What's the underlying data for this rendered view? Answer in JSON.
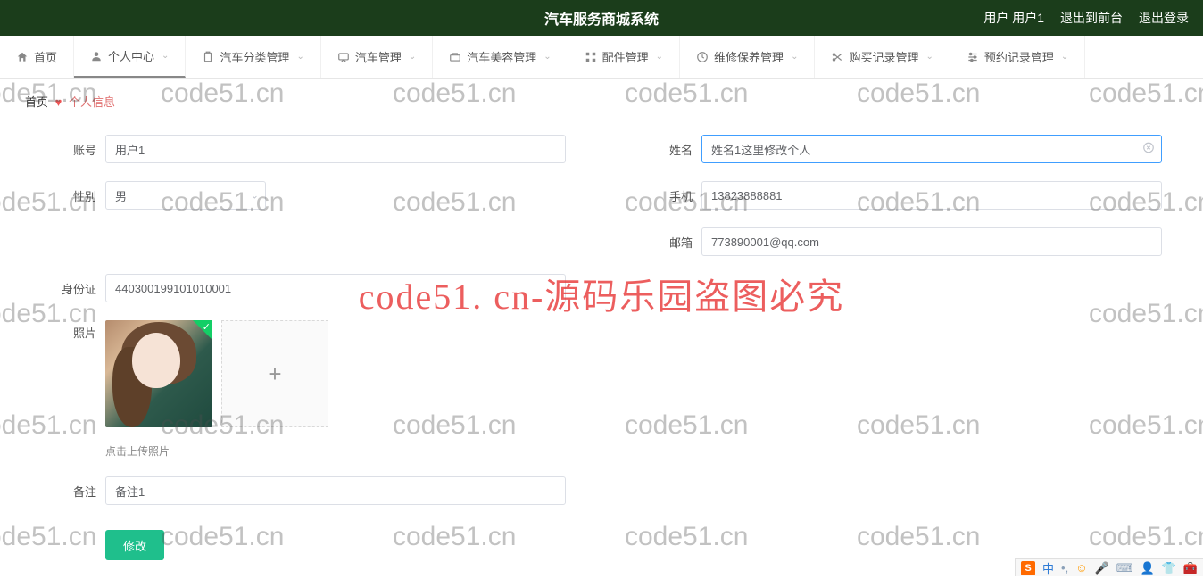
{
  "header": {
    "title": "汽车服务商城系统",
    "user_label": "用户 用户1",
    "logout_front": "退出到前台",
    "logout": "退出登录"
  },
  "nav": {
    "items": [
      {
        "label": "首页",
        "has_sub": false
      },
      {
        "label": "个人中心",
        "has_sub": true,
        "active": true
      },
      {
        "label": "汽车分类管理",
        "has_sub": true
      },
      {
        "label": "汽车管理",
        "has_sub": true
      },
      {
        "label": "汽车美容管理",
        "has_sub": true
      },
      {
        "label": "配件管理",
        "has_sub": true
      },
      {
        "label": "维修保养管理",
        "has_sub": true
      },
      {
        "label": "购买记录管理",
        "has_sub": true
      },
      {
        "label": "预约记录管理",
        "has_sub": true
      }
    ]
  },
  "breadcrumb": {
    "home": "首页",
    "current": "个人信息"
  },
  "form": {
    "account": {
      "label": "账号",
      "value": "用户1"
    },
    "name": {
      "label": "姓名",
      "value": "姓名1这里修改个人"
    },
    "gender": {
      "label": "性别",
      "value": "男"
    },
    "phone": {
      "label": "手机",
      "value": "13823888881"
    },
    "email": {
      "label": "邮箱",
      "value": "773890001@qq.com"
    },
    "idcard": {
      "label": "身份证",
      "value": "440300199101010001"
    },
    "photo": {
      "label": "照片",
      "hint": "点击上传照片"
    },
    "remark": {
      "label": "备注",
      "value": "备注1"
    },
    "submit_label": "修改"
  },
  "watermark": {
    "small": "code51.cn",
    "big": "code51. cn-源码乐园盗图必究"
  },
  "ime": {
    "mode": "中"
  }
}
